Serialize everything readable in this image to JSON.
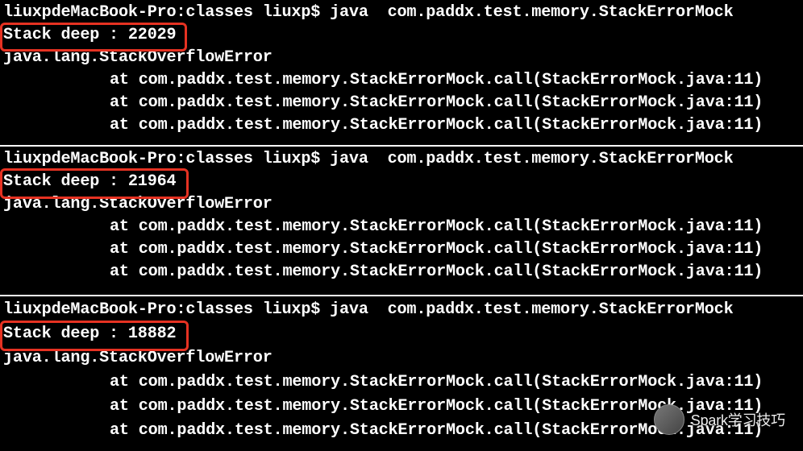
{
  "runs": [
    {
      "prompt": "liuxpdeMacBook-Pro:classes liuxp$ java  com.paddx.test.memory.StackErrorMock",
      "stack_deep": "Stack deep : 22029",
      "error": "java.lang.StackOverflowError",
      "traces": [
        "at com.paddx.test.memory.StackErrorMock.call(StackErrorMock.java:11)",
        "at com.paddx.test.memory.StackErrorMock.call(StackErrorMock.java:11)",
        "at com.paddx.test.memory.StackErrorMock.call(StackErrorMock.java:11)"
      ]
    },
    {
      "prompt": "liuxpdeMacBook-Pro:classes liuxp$ java  com.paddx.test.memory.StackErrorMock",
      "stack_deep": "Stack deep : 21964",
      "error": "java.lang.StackOverflowError",
      "traces": [
        "at com.paddx.test.memory.StackErrorMock.call(StackErrorMock.java:11)",
        "at com.paddx.test.memory.StackErrorMock.call(StackErrorMock.java:11)",
        "at com.paddx.test.memory.StackErrorMock.call(StackErrorMock.java:11)"
      ]
    },
    {
      "prompt": "liuxpdeMacBook-Pro:classes liuxp$ java  com.paddx.test.memory.StackErrorMock",
      "stack_deep": "Stack deep : 18882",
      "error": "java.lang.StackOverflowError",
      "traces": [
        "at com.paddx.test.memory.StackErrorMock.call(StackErrorMock.java:11)",
        "at com.paddx.test.memory.StackErrorMock.call(StackErrorMock.java:11)",
        "at com.paddx.test.memory.StackErrorMock.call(StackErrorMock.java:11)"
      ]
    }
  ],
  "watermark": "Spark学习技巧",
  "highlight_color": "#e63222"
}
